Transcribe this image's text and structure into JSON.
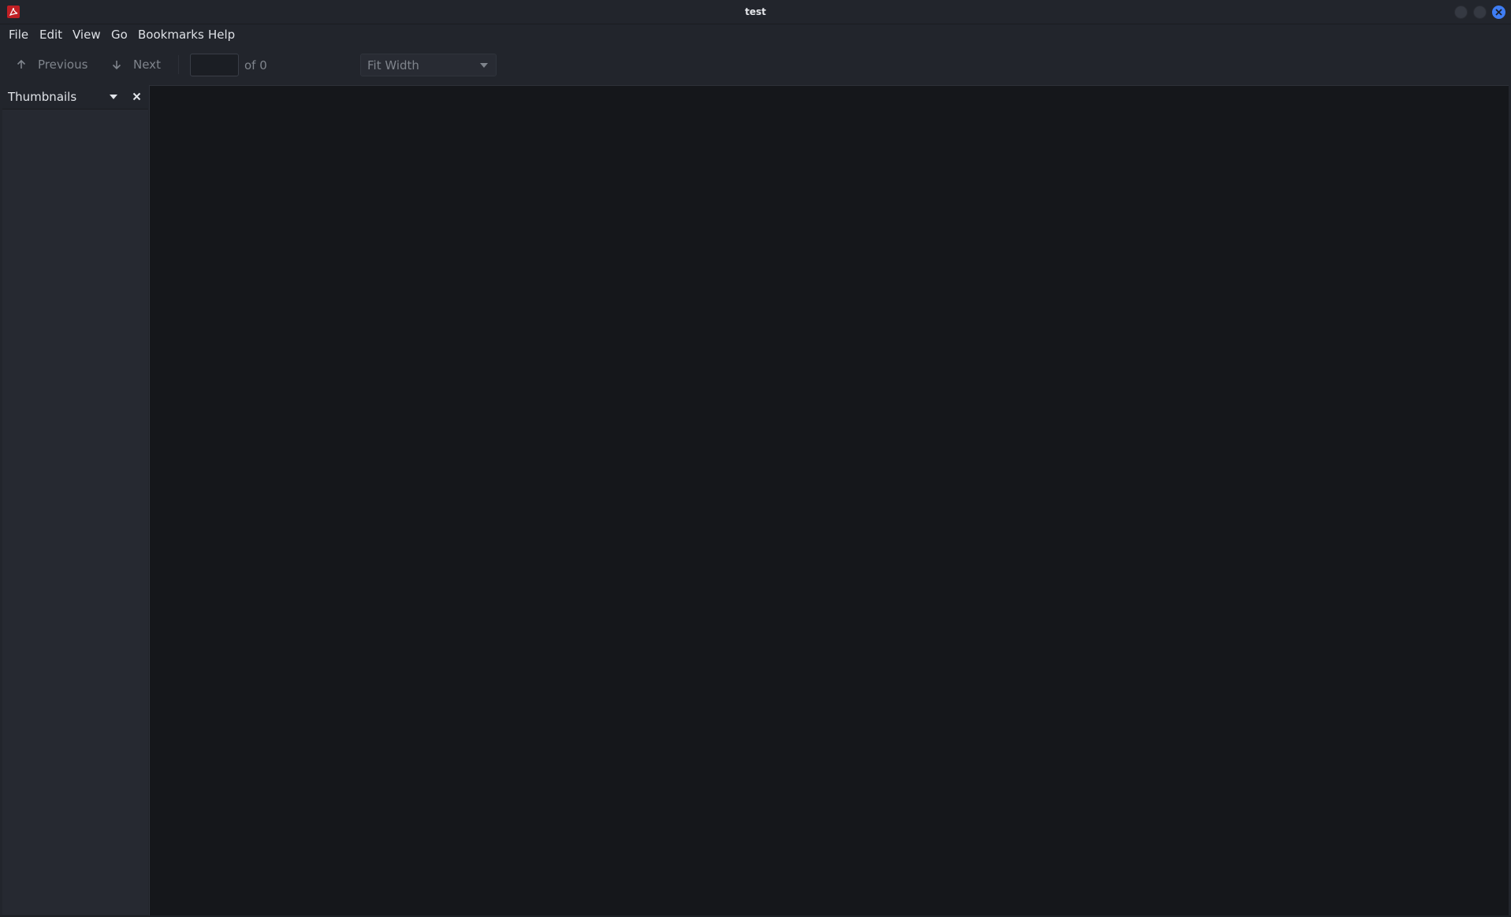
{
  "window": {
    "title": "test",
    "app_icon": "pdf-icon",
    "controls": [
      "minimize-icon",
      "maximize-icon",
      "close-icon"
    ],
    "accent_color": "#3f7df3"
  },
  "menubar": {
    "items": [
      "File",
      "Edit",
      "View",
      "Go",
      "Bookmarks",
      "Help"
    ]
  },
  "toolbar": {
    "previous_label": "Previous",
    "next_label": "Next",
    "page_value": "",
    "page_total": "of 0",
    "zoom_value": "Fit Width"
  },
  "sidebar": {
    "title": "Thumbnails"
  }
}
